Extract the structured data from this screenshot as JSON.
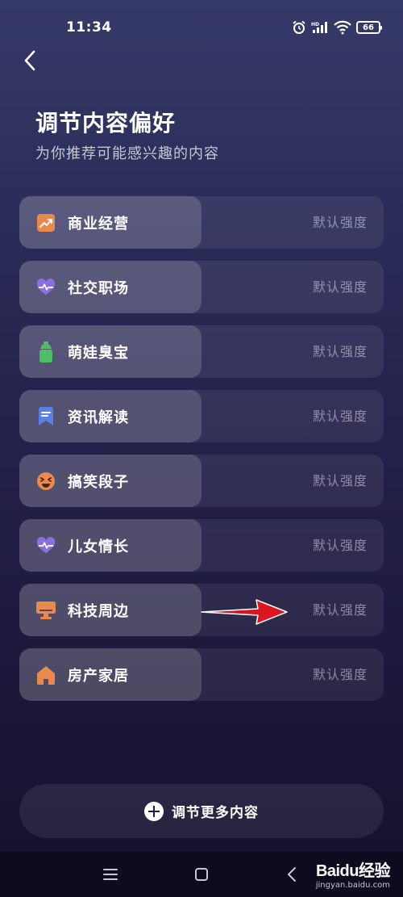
{
  "status_bar": {
    "time": "11:34",
    "battery": "66",
    "icons": [
      "alarm-icon",
      "hd-signal-icon",
      "wifi-icon",
      "battery-icon"
    ]
  },
  "header": {
    "back_icon": "chevron-left-icon",
    "title": "调节内容偏好",
    "subtitle": "为你推荐可能感兴趣的内容"
  },
  "categories": [
    {
      "label": "商业经营",
      "strength": "默认强度",
      "icon": "trend-chart-icon",
      "icon_color": "#e8894e"
    },
    {
      "label": "社交职场",
      "strength": "默认强度",
      "icon": "heart-pulse-icon",
      "icon_color": "#8b6fe0"
    },
    {
      "label": "萌娃臭宝",
      "strength": "默认强度",
      "icon": "baby-bottle-icon",
      "icon_color": "#4fbf63"
    },
    {
      "label": "资讯解读",
      "strength": "默认强度",
      "icon": "news-bookmark-icon",
      "icon_color": "#5b7fe3"
    },
    {
      "label": "搞笑段子",
      "strength": "默认强度",
      "icon": "laughing-face-icon",
      "icon_color": "#e8894e"
    },
    {
      "label": "儿女情长",
      "strength": "默认强度",
      "icon": "heart-pulse-icon",
      "icon_color": "#8b6fe0"
    },
    {
      "label": "科技周边",
      "strength": "默认强度",
      "icon": "monitor-icon",
      "icon_color": "#e8894e"
    },
    {
      "label": "房产家居",
      "strength": "默认强度",
      "icon": "house-icon",
      "icon_color": "#e8894e"
    }
  ],
  "more_button": {
    "label": "调节更多内容",
    "icon": "plus-circle-icon"
  },
  "nav_bar": {
    "buttons": [
      "menu-icon",
      "home-square-icon",
      "back-triangle-icon"
    ]
  },
  "watermark": {
    "brand": "Baidu经验",
    "url": "jingyan.baidu.com"
  },
  "annotation": {
    "arrow_color": "#e8141c"
  }
}
